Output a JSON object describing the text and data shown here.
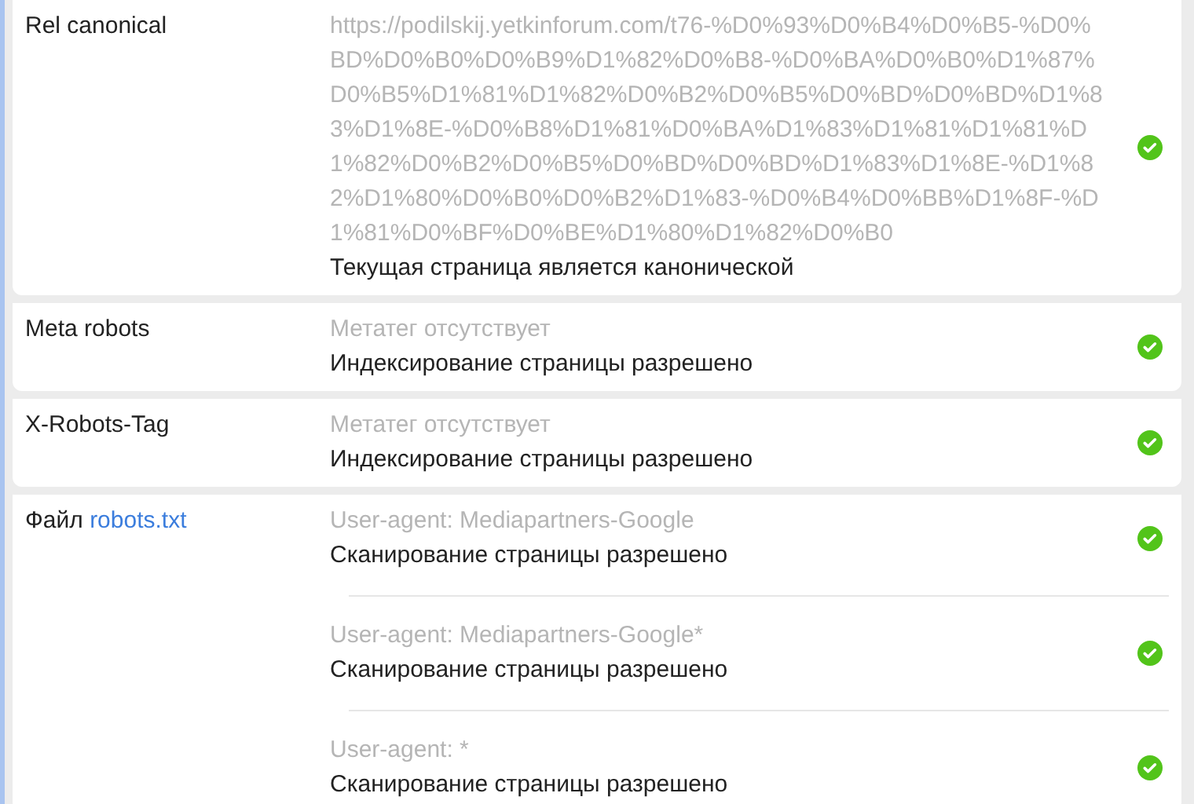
{
  "rows": [
    {
      "label": "Rel canonical",
      "entries": [
        {
          "detail": "https://podilskij.yetkinforum.com/t76-%D0%93%D0%B4%D0%B5-%D0%BD%D0%B0%D0%B9%D1%82%D0%B8-%D0%BA%D0%B0%D1%87%D0%B5%D1%81%D1%82%D0%B2%D0%B5%D0%BD%D0%BD%D1%83%D1%8E-%D0%B8%D1%81%D0%BA%D1%83%D1%81%D1%81%D1%82%D0%B2%D0%B5%D0%BD%D0%BD%D1%83%D1%8E-%D1%82%D1%80%D0%B0%D0%B2%D1%83-%D0%B4%D0%BB%D1%8F-%D1%81%D0%BF%D0%BE%D1%80%D1%82%D0%B0",
          "result": "Текущая страница является канонической",
          "passed": true
        }
      ]
    },
    {
      "label": "Meta robots",
      "entries": [
        {
          "detail": "Метатег отсутствует",
          "result": "Индексирование страницы разрешено",
          "passed": true
        }
      ]
    },
    {
      "label": "X-Robots-Tag",
      "entries": [
        {
          "detail": "Метатег отсутствует",
          "result": "Индексирование страницы разрешено",
          "passed": true
        }
      ]
    },
    {
      "label": "Файл",
      "label_link": "robots.txt",
      "entries": [
        {
          "detail": "User-agent: Mediapartners-Google",
          "result": "Сканирование страницы разрешено",
          "passed": true
        },
        {
          "detail": "User-agent: Mediapartners-Google*",
          "result": "Сканирование страницы разрешено",
          "passed": true
        },
        {
          "detail": "User-agent: *",
          "result": "Сканирование страницы разрешено",
          "passed": true
        }
      ]
    }
  ]
}
